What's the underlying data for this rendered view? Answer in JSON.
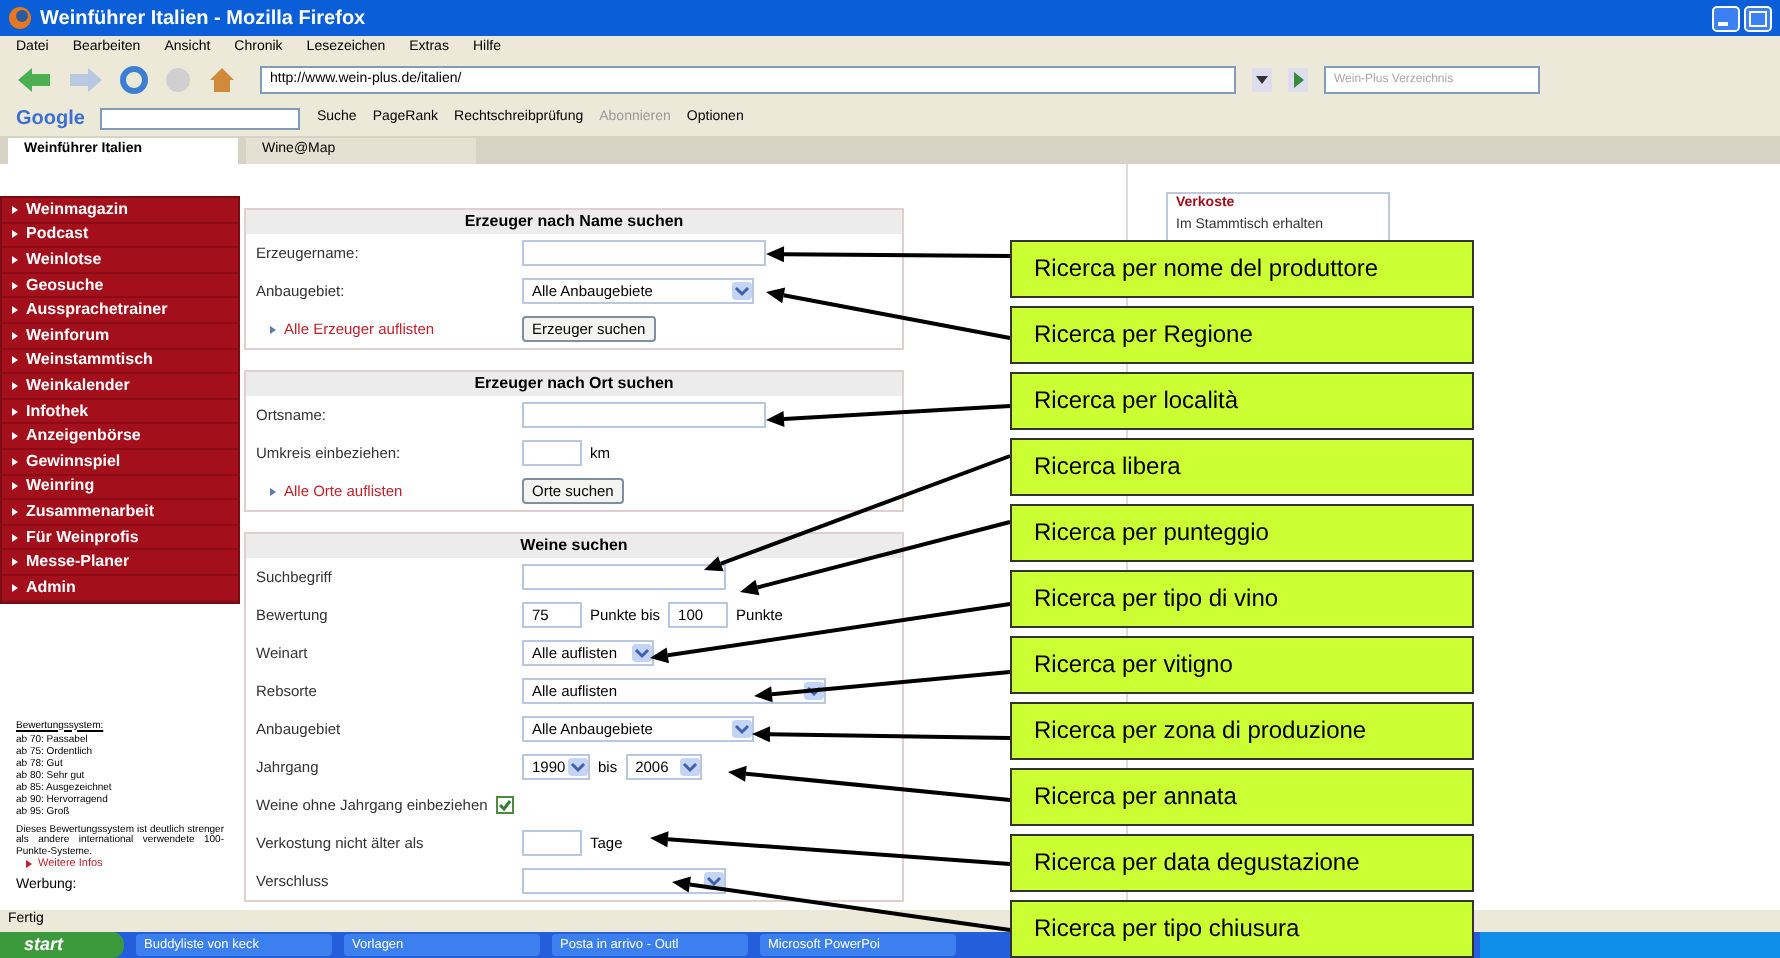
{
  "window": {
    "title": "Weinführer Italien - Mozilla Firefox"
  },
  "menu": [
    "Datei",
    "Bearbeiten",
    "Ansicht",
    "Chronik",
    "Lesezeichen",
    "Extras",
    "Hilfe"
  ],
  "address_bar": {
    "url": "http://www.wein-plus.de/italien/"
  },
  "search_box": {
    "placeholder": "Wein-Plus Verzeichnis"
  },
  "google_toolbar": {
    "logo": "Google",
    "items": [
      {
        "label": "Suche",
        "disabled": false
      },
      {
        "label": "PageRank",
        "disabled": false
      },
      {
        "label": "Rechtschreibprüfung",
        "disabled": false
      },
      {
        "label": "Abonnieren",
        "disabled": true
      },
      {
        "label": "Optionen",
        "disabled": false
      }
    ]
  },
  "tabs": [
    {
      "label": "Weinführer Italien",
      "selected": true
    },
    {
      "label": "Wine@Map",
      "selected": false
    }
  ],
  "sidebar": {
    "items": [
      "Weinmagazin",
      "Podcast",
      "Weinlotse",
      "Geosuche",
      "Aussprachetrainer",
      "Weinforum",
      "Weinstammtisch",
      "Weinkalender",
      "Infothek",
      "Anzeigenbörse",
      "Gewinnspiel",
      "Weinring",
      "Zusammenarbeit",
      "Für Weinprofis",
      "Messe-Planer",
      "Admin"
    ],
    "legend_title": "Bewertungssystem:",
    "legend": [
      "ab 70: Passabel",
      "ab 75: Ordentlich",
      "ab 78: Gut",
      "ab 80: Sehr gut",
      "ab 85: Ausgezeichnet",
      "ab 90: Hervorragend",
      "ab 95: Groß"
    ],
    "note": "Dieses Bewertungssystem ist deutlich strenger als andere international verwendete 100-Punkte-Systeme.",
    "more_link": "Weitere Infos",
    "ad_label": "Werbung:"
  },
  "panels": [
    {
      "title": "Erzeuger nach Name suchen",
      "rows": [
        {
          "kind": "text",
          "label": "Erzeugername:"
        },
        {
          "kind": "select",
          "label": "Anbaugebiet:",
          "value": "Alle Anbaugebiete"
        }
      ],
      "link": "Alle Erzeuger auflisten",
      "button": "Erzeuger suchen"
    },
    {
      "title": "Erzeuger nach Ort suchen",
      "rows": [
        {
          "kind": "text",
          "label": "Ortsname:"
        },
        {
          "kind": "unit",
          "label": "Umkreis einbeziehen:",
          "unit": "km"
        }
      ],
      "link": "Alle Orte auflisten",
      "button": "Orte suchen"
    },
    {
      "title": "Weine suchen",
      "rows": [
        {
          "kind": "text",
          "label": "Suchbegriff"
        },
        {
          "kind": "range",
          "label": "Bewertung",
          "from": "75",
          "middle": "Punkte bis",
          "to": "100",
          "unit": "Punkte"
        },
        {
          "kind": "select",
          "label": "Weinart",
          "value": "Alle auflisten"
        },
        {
          "kind": "select",
          "label": "Rebsorte",
          "value": "Alle auflisten"
        },
        {
          "kind": "select",
          "label": "Anbaugebiet",
          "value": "Alle Anbaugebiete"
        },
        {
          "kind": "years",
          "label": "Jahrgang",
          "from": "1990",
          "middle": "bis",
          "to": "2006"
        },
        {
          "kind": "checkbox",
          "label": "Weine ohne Jahrgang einbeziehen",
          "checked": true
        },
        {
          "kind": "unit",
          "label": "Verkostung nicht älter als",
          "unit": "Tage"
        },
        {
          "kind": "select",
          "label": "Verschluss"
        }
      ]
    }
  ],
  "side_box": {
    "title": "Verkoste",
    "text": "Im Stammtisch erhalten"
  },
  "callouts": [
    "Ricerca per nome del produttore",
    "Ricerca per Regione",
    "Ricerca per località",
    "Ricerca libera",
    "Ricerca per punteggio",
    "Ricerca per tipo di vino",
    "Ricerca per vitigno",
    "Ricerca per zona di produzione",
    "Ricerca per annata",
    "Ricerca per data degustazione",
    "Ricerca per tipo chiusura"
  ],
  "status_bar": "Fertig",
  "taskbar": {
    "start": "start",
    "items": [
      "Buddyliste von keck",
      "Vorlagen",
      "Posta in arrivo - Outl",
      "Microsoft PowerPoi"
    ]
  }
}
